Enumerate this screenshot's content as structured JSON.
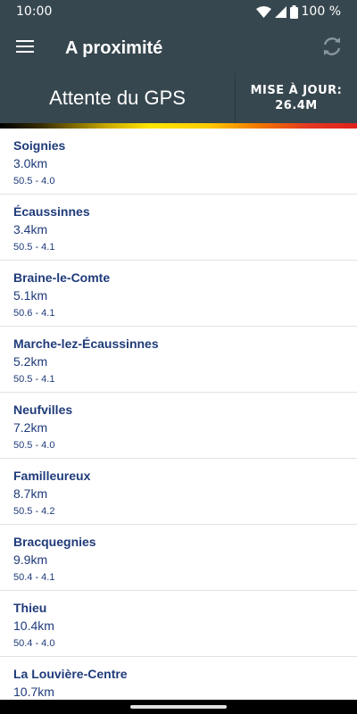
{
  "status_bar": {
    "time": "10:00",
    "battery": "100 %",
    "icons": [
      "wifi-icon",
      "signal-icon",
      "battery-icon"
    ]
  },
  "app_bar": {
    "title": "A proximité",
    "menu_icon": "menu-icon",
    "refresh_icon": "refresh-icon"
  },
  "gps_panel": {
    "status": "Attente du GPS",
    "update_label": "MISE À JOUR:",
    "update_value": "26.4M"
  },
  "colors": {
    "toolbar": "#37474f",
    "list_text": "#1f3b7a",
    "divider": "#e2e2e2"
  },
  "stations": [
    {
      "name": "Soignies",
      "distance": "3.0km",
      "coords": "50.5 - 4.0"
    },
    {
      "name": "Écaussinnes",
      "distance": "3.4km",
      "coords": "50.5 - 4.1"
    },
    {
      "name": "Braine-le-Comte",
      "distance": "5.1km",
      "coords": "50.6 - 4.1"
    },
    {
      "name": "Marche-lez-Écaussinnes",
      "distance": "5.2km",
      "coords": "50.5 - 4.1"
    },
    {
      "name": "Neufvilles",
      "distance": "7.2km",
      "coords": "50.5 - 4.0"
    },
    {
      "name": "Familleureux",
      "distance": "8.7km",
      "coords": "50.5 - 4.2"
    },
    {
      "name": "Bracquegnies",
      "distance": "9.9km",
      "coords": "50.4 - 4.1"
    },
    {
      "name": "Thieu",
      "distance": "10.4km",
      "coords": "50.4 - 4.0"
    },
    {
      "name": "La Louvière-Centre",
      "distance": "10.7km",
      "coords": ""
    }
  ]
}
